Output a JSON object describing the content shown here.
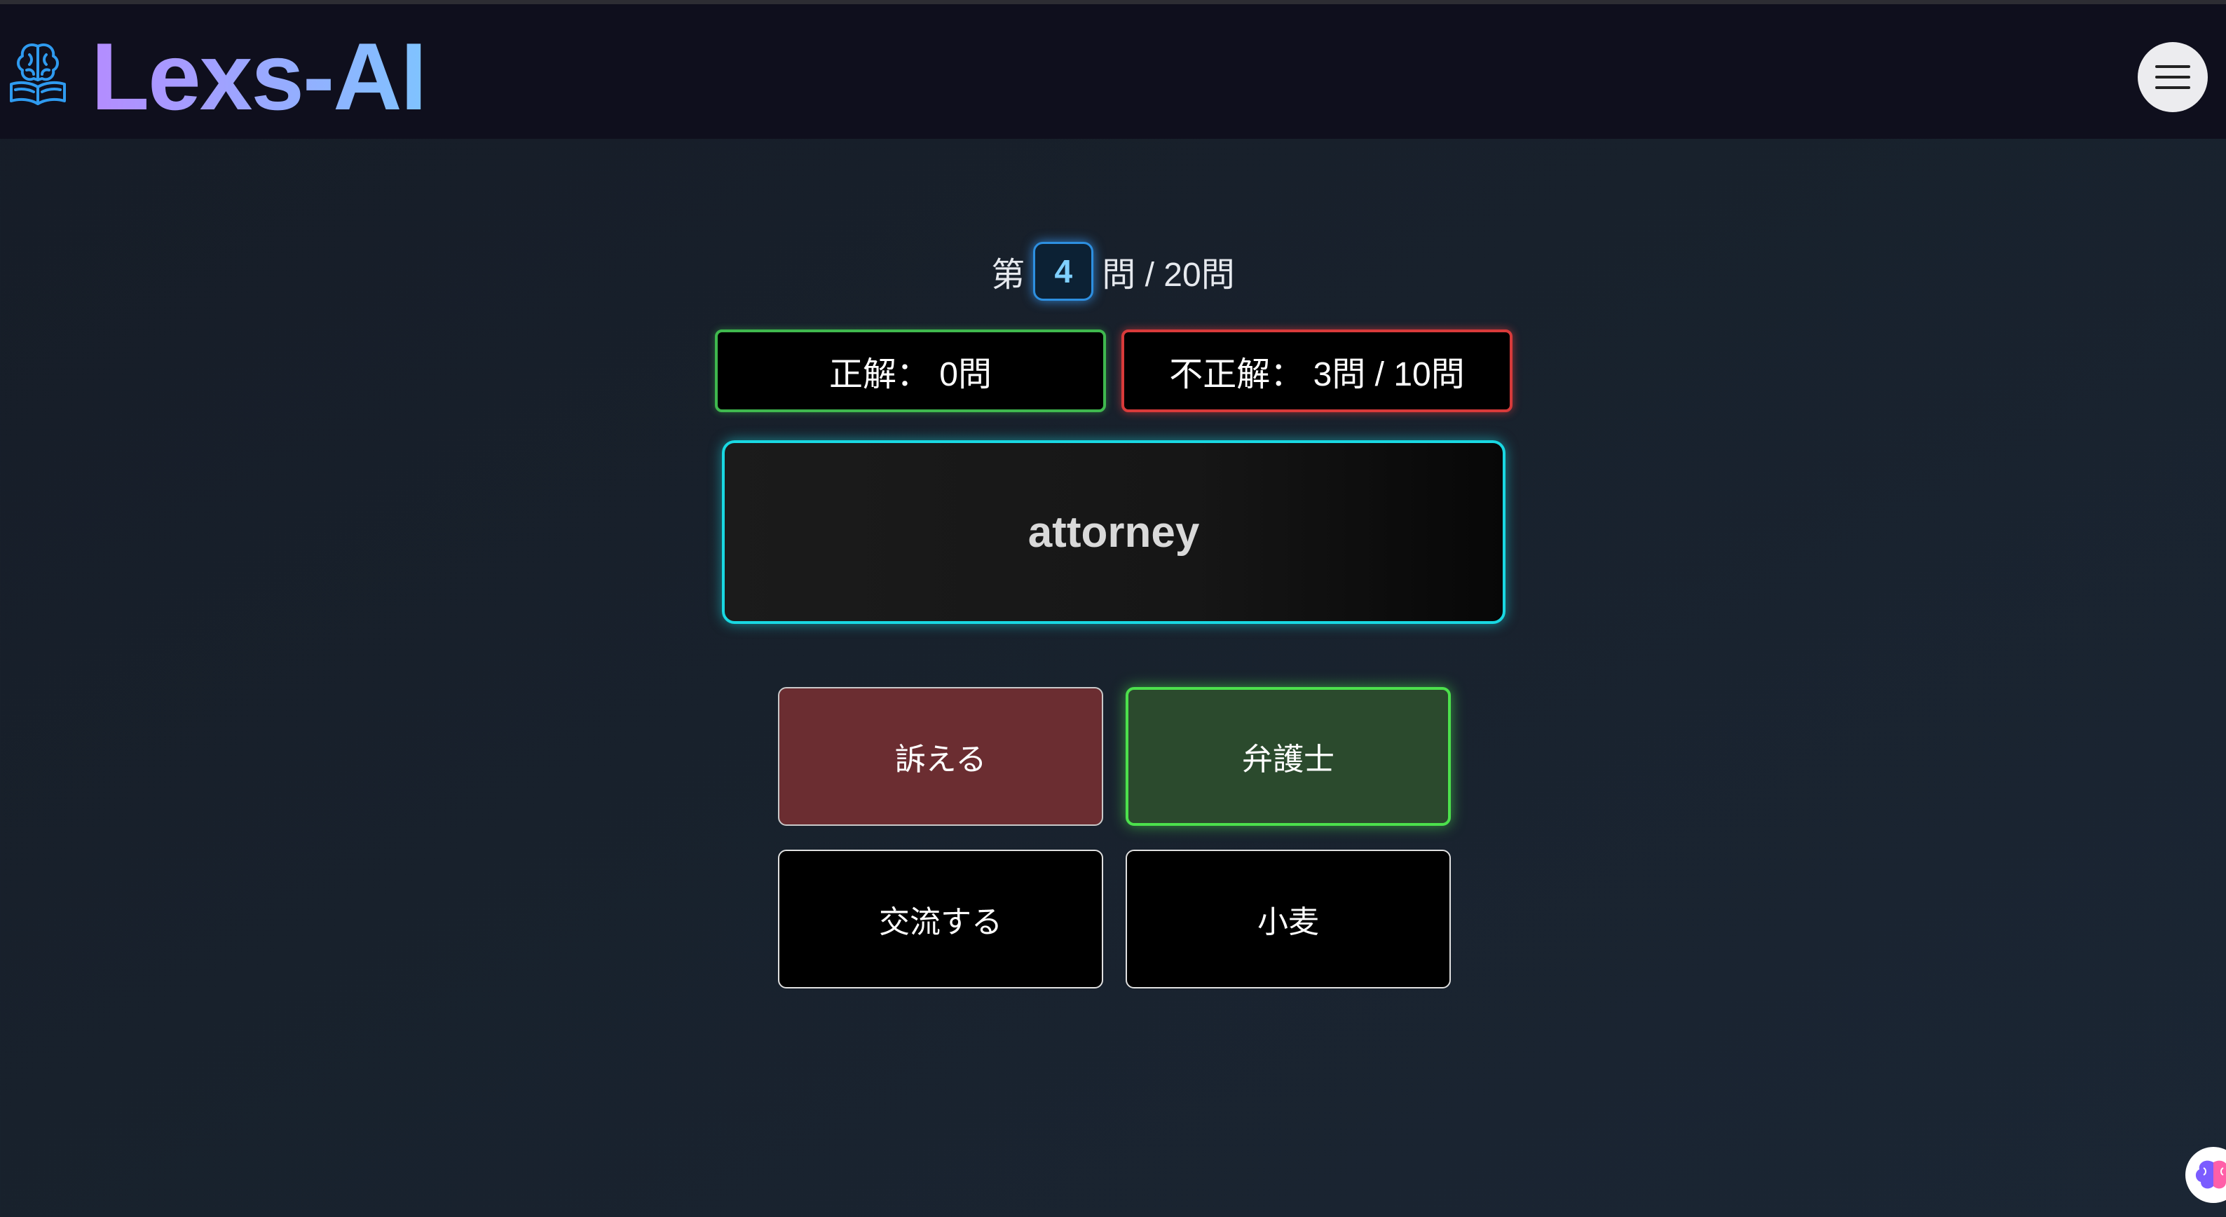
{
  "header": {
    "logo_icon": "brain-book-icon",
    "brand": "Lexs-AI",
    "menu_icon": "hamburger-icon"
  },
  "quiz": {
    "progress_prefix": "第",
    "current_question": "4",
    "progress_suffix": "問 / 20問",
    "correct_label": "正解： 0問",
    "incorrect_label": "不正解： 3問 / 10問",
    "word": "attorney",
    "options": [
      {
        "label": "訴える",
        "state": "wrong"
      },
      {
        "label": "弁護士",
        "state": "correct"
      },
      {
        "label": "交流する",
        "state": "default"
      },
      {
        "label": "小麦",
        "state": "default"
      }
    ]
  },
  "assistant": {
    "icon": "brain-icon"
  },
  "colors": {
    "correct": "#4ce04c",
    "incorrect": "#d83a3a",
    "word_border": "#19d8e2",
    "question_badge": "#2d8fe0"
  }
}
